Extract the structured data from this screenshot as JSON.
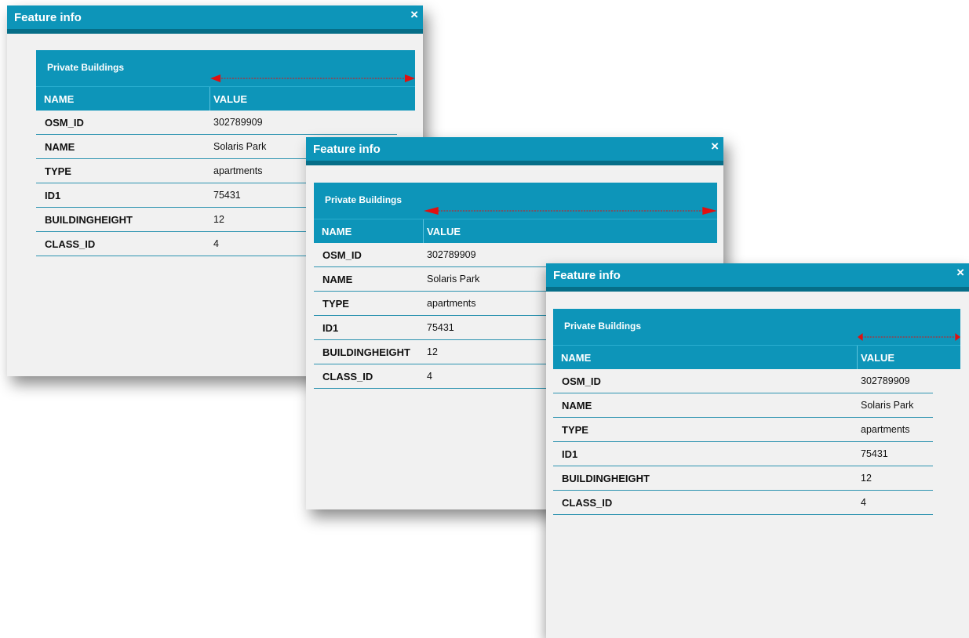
{
  "dialog": {
    "title": "Feature info",
    "close_label": "×",
    "layer_name": "Private Buildings",
    "columns": {
      "name": "NAME",
      "value": "VALUE"
    },
    "rows": [
      {
        "name": "OSM_ID",
        "value": "302789909"
      },
      {
        "name": "NAME",
        "value": "Solaris Park"
      },
      {
        "name": "TYPE",
        "value": "apartments"
      },
      {
        "name": "ID1",
        "value": "75431"
      },
      {
        "name": "BUILDINGHEIGHT",
        "value": "12"
      },
      {
        "name": "CLASS_ID",
        "value": "4"
      }
    ]
  },
  "colors": {
    "header": "#0d95b9",
    "header_dark": "#066e88",
    "arrow": "#e01010",
    "panel": "#f1f1f1"
  },
  "icons": {
    "close": "close-icon",
    "resize_arrow": "double-arrow-icon"
  }
}
